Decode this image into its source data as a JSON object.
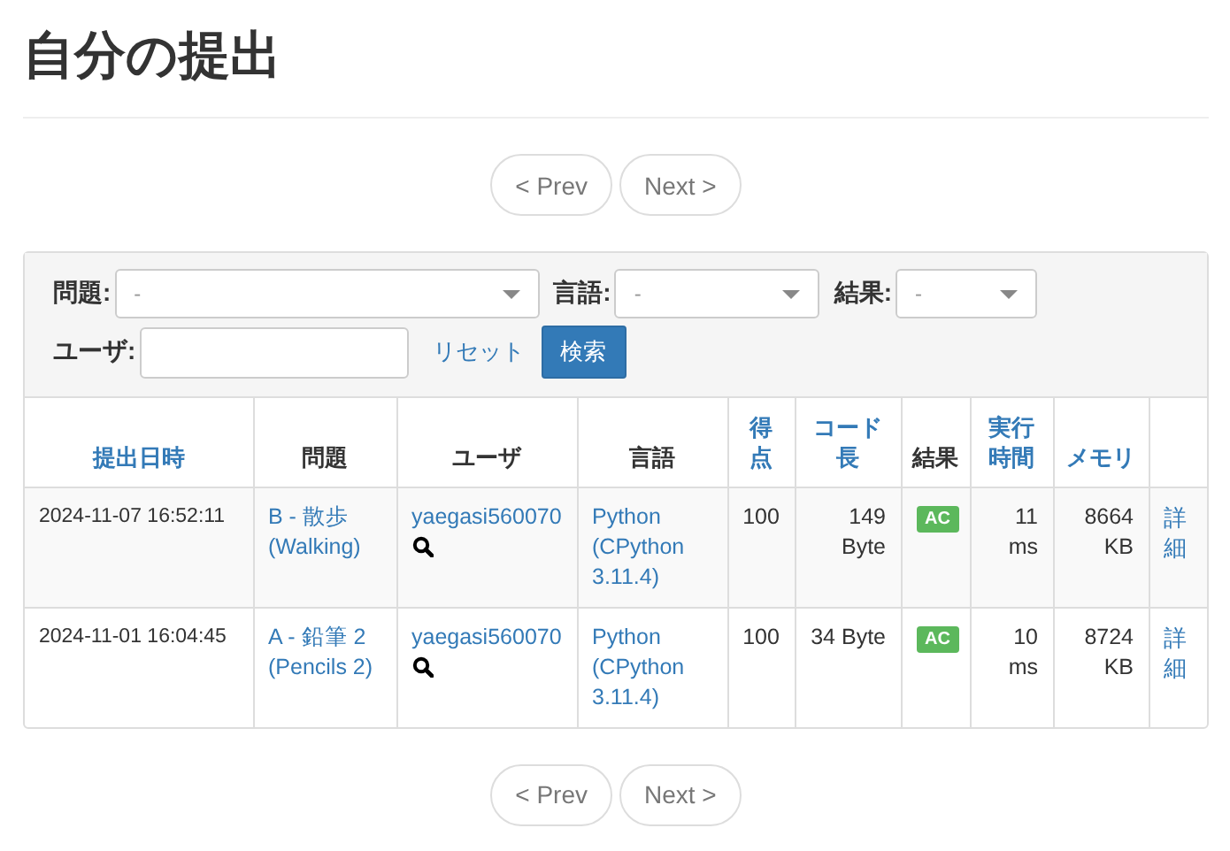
{
  "title": "自分の提出",
  "pagination_top": [
    {
      "label": "< Prev",
      "disabled": true
    },
    {
      "label": "Next >",
      "disabled": true
    }
  ],
  "filters": {
    "problem": {
      "label": "問題:",
      "value": "-"
    },
    "language": {
      "label": "言語:",
      "value": "-"
    },
    "result": {
      "label": "結果:",
      "value": "-"
    },
    "user": {
      "label": "ユーザ:"
    },
    "reset": "リセット",
    "search": "検索"
  },
  "table": {
    "columns": [
      {
        "label": "提出日時",
        "sortable": true
      },
      {
        "label": "問題",
        "sortable": false
      },
      {
        "label": "ユーザ",
        "sortable": false
      },
      {
        "label": "言語",
        "sortable": false
      },
      {
        "label": "得点",
        "sortable": true
      },
      {
        "label": "コード長",
        "sortable": true
      },
      {
        "label": "結果",
        "sortable": false
      },
      {
        "label": "実行時間",
        "sortable": true
      },
      {
        "label": "メモリ",
        "sortable": true
      }
    ],
    "rows": [
      {
        "submitted": "2024-11-07 16:52:11",
        "problem": "B - 散歩 (Walking)",
        "user": "yaegasi560070",
        "language": "Python (CPython 3.11.4)",
        "score": "100",
        "code_length": "149 Byte",
        "result": "AC",
        "color": "#5cb85c",
        "time": "11 ms",
        "memory": "8664 KB",
        "detail": "詳細"
      },
      {
        "submitted": "2024-11-01 16:04:45",
        "problem": "A - 鉛筆 2 (Pencils 2)",
        "user": "yaegasi560070",
        "language": "Python (CPython 3.11.4)",
        "score": "100",
        "code_length": "34 Byte",
        "result": "AC",
        "color": "#5cb85c",
        "time": "10 ms",
        "memory": "8724 KB",
        "detail": "詳細"
      }
    ]
  },
  "pagination_bottom": [
    {
      "label": "< Prev",
      "disabled": true
    },
    {
      "label": "Next >",
      "disabled": true
    }
  ]
}
